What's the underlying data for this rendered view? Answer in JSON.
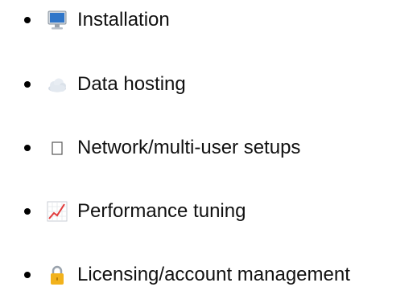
{
  "items": [
    {
      "icon": "desktop-computer-icon",
      "label": "Installation"
    },
    {
      "icon": "cloud-icon",
      "label": "Data hosting"
    },
    {
      "icon": "missing-glyph-box-icon",
      "label": "Network/multi-user setups"
    },
    {
      "icon": "chart-increasing-icon",
      "label": "Performance tuning"
    },
    {
      "icon": "lock-icon",
      "label": "Licensing/account management"
    }
  ],
  "colors": {
    "text": "#111111",
    "bullet": "#000000",
    "monitor_screen": "#2f76c9",
    "cloud": "#dfe6ee",
    "lock_body": "#f2b21c",
    "lock_shackle": "#9aa3ad",
    "chart_line": "#e23b3b"
  }
}
